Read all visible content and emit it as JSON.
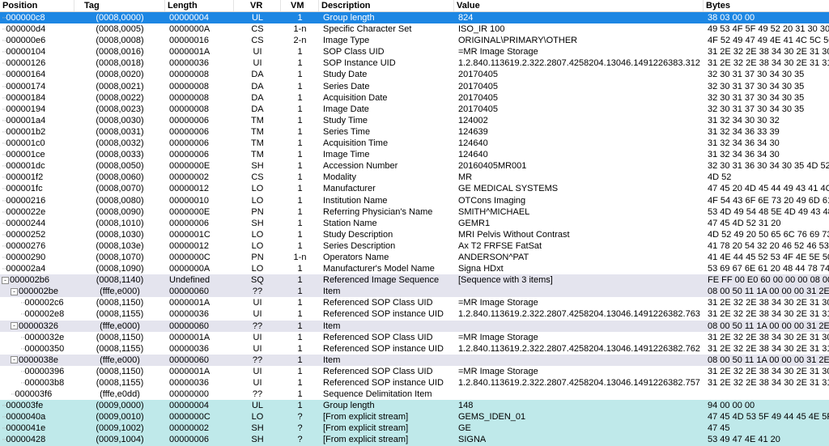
{
  "columns": {
    "position": "Position",
    "tag": "Tag",
    "length": "Length",
    "vr": "VR",
    "vm": "VM",
    "description": "Description",
    "value": "Value",
    "bytes": "Bytes"
  },
  "rows": [
    {
      "pos": "000000c8",
      "tag": "(0008,0000)",
      "len": "00000004",
      "vr": "UL",
      "vm": "1",
      "desc": "Group length",
      "val": "824",
      "bytes": "38 03 00 00",
      "kind": "sel",
      "level": 0
    },
    {
      "pos": "000000d4",
      "tag": "(0008,0005)",
      "len": "0000000A",
      "vr": "CS",
      "vm": "1-n",
      "desc": "Specific Character Set",
      "val": "ISO_IR 100",
      "bytes": "49 53 4F 5F 49 52 20 31 30 30",
      "kind": "",
      "level": 0
    },
    {
      "pos": "000000e6",
      "tag": "(0008,0008)",
      "len": "00000016",
      "vr": "CS",
      "vm": "2-n",
      "desc": "Image Type",
      "val": "ORIGINAL\\PRIMARY\\OTHER",
      "bytes": "4F 52 49 47 49 4E 41 4C 5C 50 52 4...",
      "kind": "",
      "level": 0
    },
    {
      "pos": "00000104",
      "tag": "(0008,0016)",
      "len": "0000001A",
      "vr": "UI",
      "vm": "1",
      "desc": "SOP Class UID",
      "val": "=MR Image Storage",
      "bytes": "31 2E 32 2E 38 34 30 2E 31 30 30 3...",
      "kind": "",
      "level": 0
    },
    {
      "pos": "00000126",
      "tag": "(0008,0018)",
      "len": "00000036",
      "vr": "UI",
      "vm": "1",
      "desc": "SOP Instance UID",
      "val": "1.2.840.113619.2.322.2807.4258204.13046.1491226383.312",
      "bytes": "31 2E 32 2E 38 34 30 2E 31 31 33 3...",
      "kind": "",
      "level": 0
    },
    {
      "pos": "00000164",
      "tag": "(0008,0020)",
      "len": "00000008",
      "vr": "DA",
      "vm": "1",
      "desc": "Study Date",
      "val": "20170405",
      "bytes": "32 30 31 37 30 34 30 35",
      "kind": "",
      "level": 0
    },
    {
      "pos": "00000174",
      "tag": "(0008,0021)",
      "len": "00000008",
      "vr": "DA",
      "vm": "1",
      "desc": "Series Date",
      "val": "20170405",
      "bytes": "32 30 31 37 30 34 30 35",
      "kind": "",
      "level": 0
    },
    {
      "pos": "00000184",
      "tag": "(0008,0022)",
      "len": "00000008",
      "vr": "DA",
      "vm": "1",
      "desc": "Acquisition Date",
      "val": "20170405",
      "bytes": "32 30 31 37 30 34 30 35",
      "kind": "",
      "level": 0
    },
    {
      "pos": "00000194",
      "tag": "(0008,0023)",
      "len": "00000008",
      "vr": "DA",
      "vm": "1",
      "desc": "Image Date",
      "val": "20170405",
      "bytes": "32 30 31 37 30 34 30 35",
      "kind": "",
      "level": 0
    },
    {
      "pos": "000001a4",
      "tag": "(0008,0030)",
      "len": "00000006",
      "vr": "TM",
      "vm": "1",
      "desc": "Study Time",
      "val": "124002",
      "bytes": "31 32 34 30 30 32",
      "kind": "",
      "level": 0
    },
    {
      "pos": "000001b2",
      "tag": "(0008,0031)",
      "len": "00000006",
      "vr": "TM",
      "vm": "1",
      "desc": "Series Time",
      "val": "124639",
      "bytes": "31 32 34 36 33 39",
      "kind": "",
      "level": 0
    },
    {
      "pos": "000001c0",
      "tag": "(0008,0032)",
      "len": "00000006",
      "vr": "TM",
      "vm": "1",
      "desc": "Acquisition Time",
      "val": "124640",
      "bytes": "31 32 34 36 34 30",
      "kind": "",
      "level": 0
    },
    {
      "pos": "000001ce",
      "tag": "(0008,0033)",
      "len": "00000006",
      "vr": "TM",
      "vm": "1",
      "desc": "Image Time",
      "val": "124640",
      "bytes": "31 32 34 36 34 30",
      "kind": "",
      "level": 0
    },
    {
      "pos": "000001dc",
      "tag": "(0008,0050)",
      "len": "0000000E",
      "vr": "SH",
      "vm": "1",
      "desc": "Accession Number",
      "val": "20160405MR001",
      "bytes": "32 30 31 36 30 34 30 35 4D 52 30 30...",
      "kind": "",
      "level": 0
    },
    {
      "pos": "000001f2",
      "tag": "(0008,0060)",
      "len": "00000002",
      "vr": "CS",
      "vm": "1",
      "desc": "Modality",
      "val": "MR",
      "bytes": "4D 52",
      "kind": "",
      "level": 0
    },
    {
      "pos": "000001fc",
      "tag": "(0008,0070)",
      "len": "00000012",
      "vr": "LO",
      "vm": "1",
      "desc": "Manufacturer",
      "val": "GE MEDICAL SYSTEMS",
      "bytes": "47 45 20 4D 45 44 49 43 41 4C 20 5...",
      "kind": "",
      "level": 0
    },
    {
      "pos": "00000216",
      "tag": "(0008,0080)",
      "len": "00000010",
      "vr": "LO",
      "vm": "1",
      "desc": "Institution Name",
      "val": "OTCons Imaging",
      "bytes": "4F 54 43 6F 6E 73 20 49 6D 61 67 6...",
      "kind": "",
      "level": 0
    },
    {
      "pos": "0000022e",
      "tag": "(0008,0090)",
      "len": "0000000E",
      "vr": "PN",
      "vm": "1",
      "desc": "Referring Physician's Name",
      "val": "SMITH^MICHAEL",
      "bytes": "53 4D 49 54 48 5E 4D 49 43 48 41 4...",
      "kind": "",
      "level": 0
    },
    {
      "pos": "00000244",
      "tag": "(0008,1010)",
      "len": "00000006",
      "vr": "SH",
      "vm": "1",
      "desc": "Station Name",
      "val": "GEMR1",
      "bytes": "47 45 4D 52 31 20",
      "kind": "",
      "level": 0
    },
    {
      "pos": "00000252",
      "tag": "(0008,1030)",
      "len": "0000001C",
      "vr": "LO",
      "vm": "1",
      "desc": "Study Description",
      "val": "MRI Pelvis Without Contrast",
      "bytes": "4D 52 49 20 50 65 6C 76 69 73 20 5...",
      "kind": "",
      "level": 0
    },
    {
      "pos": "00000276",
      "tag": "(0008,103e)",
      "len": "00000012",
      "vr": "LO",
      "vm": "1",
      "desc": "Series Description",
      "val": "Ax T2 FRFSE FatSat",
      "bytes": "41 78 20 54 32 20 46 52 46 53 45 20...",
      "kind": "",
      "level": 0
    },
    {
      "pos": "00000290",
      "tag": "(0008,1070)",
      "len": "0000000C",
      "vr": "PN",
      "vm": "1-n",
      "desc": "Operators Name",
      "val": "ANDERSON^PAT",
      "bytes": "41 4E 44 45 52 53 4F 4E 5E 50 41 54",
      "kind": "",
      "level": 0
    },
    {
      "pos": "000002a4",
      "tag": "(0008,1090)",
      "len": "0000000A",
      "vr": "LO",
      "vm": "1",
      "desc": "Manufacturer's Model Name",
      "val": "Signa HDxt",
      "bytes": "53 69 67 6E 61 20 48 44 78 74",
      "kind": "",
      "level": 0
    },
    {
      "pos": "000002b6",
      "tag": "(0008,1140)",
      "len": "Undefined",
      "vr": "SQ",
      "vm": "1",
      "desc": "Referenced Image Sequence",
      "val": "[Sequence with 3 items]",
      "bytes": "FE FF 00 E0 60 00 00 00 08 00 50 1...",
      "kind": "seq",
      "level": 0,
      "tree": "-"
    },
    {
      "pos": "000002be",
      "tag": "(fffe,e000)",
      "len": "00000060",
      "vr": "??",
      "vm": "1",
      "desc": "Item",
      "val": "",
      "bytes": "08 00 50 11 1A 00 00 00 31 2E 32 2E...",
      "kind": "seq",
      "level": 1,
      "tree": "-"
    },
    {
      "pos": "000002c6",
      "tag": "(0008,1150)",
      "len": "0000001A",
      "vr": "UI",
      "vm": "1",
      "desc": "Referenced SOP Class UID",
      "val": "=MR Image Storage",
      "bytes": "31 2E 32 2E 38 34 30 2E 31 30 30 3...",
      "kind": "",
      "level": 2
    },
    {
      "pos": "000002e8",
      "tag": "(0008,1155)",
      "len": "00000036",
      "vr": "UI",
      "vm": "1",
      "desc": "Referenced SOP instance UID",
      "val": "1.2.840.113619.2.322.2807.4258204.13046.1491226382.763",
      "bytes": "31 2E 32 2E 38 34 30 2E 31 31 33 3...",
      "kind": "",
      "level": 2
    },
    {
      "pos": "00000326",
      "tag": "(fffe,e000)",
      "len": "00000060",
      "vr": "??",
      "vm": "1",
      "desc": "Item",
      "val": "",
      "bytes": "08 00 50 11 1A 00 00 00 31 2E 32 2E...",
      "kind": "seq",
      "level": 1,
      "tree": "-"
    },
    {
      "pos": "0000032e",
      "tag": "(0008,1150)",
      "len": "0000001A",
      "vr": "UI",
      "vm": "1",
      "desc": "Referenced SOP Class UID",
      "val": "=MR Image Storage",
      "bytes": "31 2E 32 2E 38 34 30 2E 31 30 30 3...",
      "kind": "",
      "level": 2
    },
    {
      "pos": "00000350",
      "tag": "(0008,1155)",
      "len": "00000036",
      "vr": "UI",
      "vm": "1",
      "desc": "Referenced SOP instance UID",
      "val": "1.2.840.113619.2.322.2807.4258204.13046.1491226382.762",
      "bytes": "31 2E 32 2E 38 34 30 2E 31 31 33 3...",
      "kind": "",
      "level": 2
    },
    {
      "pos": "0000038e",
      "tag": "(fffe,e000)",
      "len": "00000060",
      "vr": "??",
      "vm": "1",
      "desc": "Item",
      "val": "",
      "bytes": "08 00 50 11 1A 00 00 00 31 2E 32 2E...",
      "kind": "seq",
      "level": 1,
      "tree": "-"
    },
    {
      "pos": "00000396",
      "tag": "(0008,1150)",
      "len": "0000001A",
      "vr": "UI",
      "vm": "1",
      "desc": "Referenced SOP Class UID",
      "val": "=MR Image Storage",
      "bytes": "31 2E 32 2E 38 34 30 2E 31 30 30 3...",
      "kind": "",
      "level": 2
    },
    {
      "pos": "000003b8",
      "tag": "(0008,1155)",
      "len": "00000036",
      "vr": "UI",
      "vm": "1",
      "desc": "Referenced SOP instance UID",
      "val": "1.2.840.113619.2.322.2807.4258204.13046.1491226382.757",
      "bytes": "31 2E 32 2E 38 34 30 2E 31 31 33 3...",
      "kind": "",
      "level": 2
    },
    {
      "pos": "000003f6",
      "tag": "(fffe,e0dd)",
      "len": "00000000",
      "vr": "??",
      "vm": "1",
      "desc": "Sequence Delimitation Item",
      "val": "",
      "bytes": "",
      "kind": "",
      "level": 1
    },
    {
      "pos": "000003fe",
      "tag": "(0009,0000)",
      "len": "00000004",
      "vr": "UL",
      "vm": "1",
      "desc": "Group length",
      "val": "148",
      "bytes": "94 00 00 00",
      "kind": "grp",
      "level": 0
    },
    {
      "pos": "0000040a",
      "tag": "(0009,0010)",
      "len": "0000000C",
      "vr": "LO",
      "vm": "?",
      "desc": "[From explicit stream]",
      "val": "GEMS_IDEN_01",
      "bytes": "47 45 4D 53 5F 49 44 45 4E 5F 30 31",
      "kind": "grp",
      "level": 0
    },
    {
      "pos": "0000041e",
      "tag": "(0009,1002)",
      "len": "00000002",
      "vr": "SH",
      "vm": "?",
      "desc": "[From explicit stream]",
      "val": "GE",
      "bytes": "47 45",
      "kind": "grp",
      "level": 0
    },
    {
      "pos": "00000428",
      "tag": "(0009,1004)",
      "len": "00000006",
      "vr": "SH",
      "vm": "?",
      "desc": "[From explicit stream]",
      "val": "SIGNA",
      "bytes": "53 49 47 4E 41 20",
      "kind": "grp",
      "level": 0
    }
  ],
  "colors": {
    "selected": "#1c86e3",
    "sequence": "#e4e4ee",
    "group": "#bfe9ea"
  }
}
